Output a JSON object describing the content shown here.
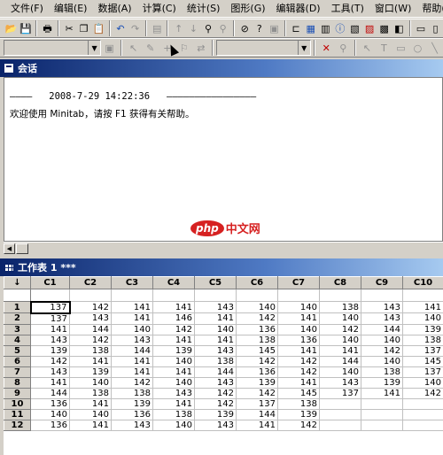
{
  "menu": [
    "文件(F)",
    "编辑(E)",
    "数据(A)",
    "计算(C)",
    "统计(S)",
    "图形(G)",
    "编辑器(D)",
    "工具(T)",
    "窗口(W)",
    "帮助(H)"
  ],
  "session": {
    "title": "会话",
    "header_line": "————   2008-7-29 14:22:36   ————————————————",
    "welcome": "欢迎使用 Minitab，请按 F1 获得有关帮助。"
  },
  "watermark": {
    "logo": "php",
    "text": "中文网"
  },
  "worksheet": {
    "title": "工作表 1 ***",
    "corner": "↓",
    "columns": [
      "C1",
      "C2",
      "C3",
      "C4",
      "C5",
      "C6",
      "C7",
      "C8",
      "C9",
      "C10"
    ],
    "rows": [
      {
        "n": "1",
        "v": [
          "137",
          "142",
          "141",
          "141",
          "143",
          "140",
          "140",
          "138",
          "143",
          "141"
        ]
      },
      {
        "n": "2",
        "v": [
          "137",
          "143",
          "141",
          "146",
          "141",
          "142",
          "141",
          "140",
          "143",
          "140"
        ]
      },
      {
        "n": "3",
        "v": [
          "141",
          "144",
          "140",
          "142",
          "140",
          "136",
          "140",
          "142",
          "144",
          "139"
        ]
      },
      {
        "n": "4",
        "v": [
          "143",
          "142",
          "143",
          "141",
          "141",
          "138",
          "136",
          "140",
          "140",
          "138"
        ]
      },
      {
        "n": "5",
        "v": [
          "139",
          "138",
          "144",
          "139",
          "143",
          "145",
          "141",
          "141",
          "142",
          "137"
        ]
      },
      {
        "n": "6",
        "v": [
          "142",
          "141",
          "141",
          "140",
          "138",
          "142",
          "142",
          "144",
          "140",
          "145"
        ]
      },
      {
        "n": "7",
        "v": [
          "143",
          "139",
          "141",
          "141",
          "144",
          "136",
          "142",
          "140",
          "138",
          "137"
        ]
      },
      {
        "n": "8",
        "v": [
          "141",
          "140",
          "142",
          "140",
          "143",
          "139",
          "141",
          "143",
          "139",
          "140"
        ]
      },
      {
        "n": "9",
        "v": [
          "144",
          "138",
          "138",
          "143",
          "142",
          "142",
          "145",
          "137",
          "141",
          "142"
        ]
      },
      {
        "n": "10",
        "v": [
          "136",
          "141",
          "139",
          "141",
          "142",
          "137",
          "138",
          "",
          "",
          ""
        ]
      },
      {
        "n": "11",
        "v": [
          "140",
          "140",
          "136",
          "138",
          "139",
          "144",
          "139",
          "",
          "",
          ""
        ]
      },
      {
        "n": "12",
        "v": [
          "136",
          "141",
          "143",
          "140",
          "143",
          "141",
          "142",
          "",
          "",
          ""
        ]
      }
    ]
  }
}
